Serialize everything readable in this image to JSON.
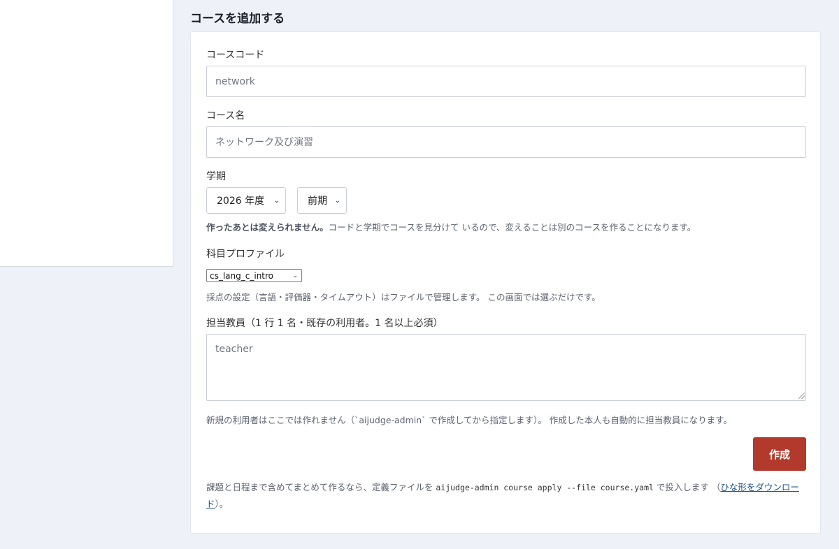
{
  "page": {
    "title": "コースを追加する"
  },
  "form": {
    "course_code": {
      "label": "コースコード",
      "placeholder": "network"
    },
    "course_name": {
      "label": "コース名",
      "placeholder": "ネットワーク及び演習"
    },
    "term": {
      "label": "学期",
      "year_selected": "2026 年度",
      "semester_selected": "前期",
      "help_strong": "作ったあとは変えられません。",
      "help_text": "コードと学期でコースを見分けて いるので、変えることは別のコースを作ることになります。"
    },
    "profile": {
      "label": "科目プロファイル",
      "selected": "cs_lang_c_intro",
      "help": "採点の設定（言語・評価器・タイムアウト）はファイルで管理します。 この画面では選ぶだけです。"
    },
    "teachers": {
      "label": "担当教員（1 行 1 名・既存の利用者。1 名以上必須）",
      "placeholder": "teacher",
      "help": "新規の利用者はここでは作れません（`aijudge-admin` で作成してから指定します）。 作成した本人も自動的に担当教員になります。"
    },
    "submit_label": "作成"
  },
  "footer": {
    "text_before": "課題と日程まで含めてまとめて作るなら、定義ファイルを ",
    "command": "aijudge-admin course apply --file course.yaml",
    "text_middle": " で投入します （",
    "link_label": "ひな形をダウンロード",
    "text_after": "）。"
  },
  "colors": {
    "background": "#eef1f8",
    "primary_button": "#b13a2d",
    "link": "#1d4f7a"
  }
}
